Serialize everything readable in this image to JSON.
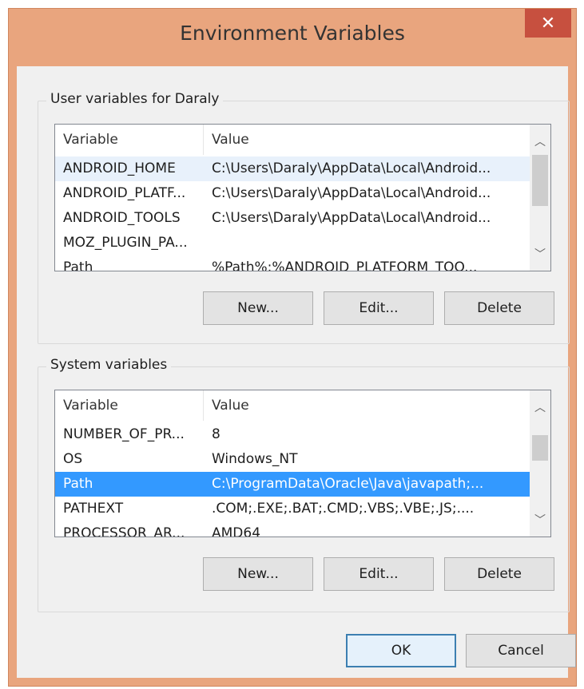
{
  "window": {
    "title": "Environment Variables",
    "close_glyph": "✕"
  },
  "user_group": {
    "label": "User variables for Daraly",
    "headers": {
      "variable": "Variable",
      "value": "Value"
    },
    "rows": [
      {
        "variable": "ANDROID_HOME",
        "value": "C:\\Users\\Daraly\\AppData\\Local\\Android..."
      },
      {
        "variable": "ANDROID_PLATF...",
        "value": "C:\\Users\\Daraly\\AppData\\Local\\Android..."
      },
      {
        "variable": "ANDROID_TOOLS",
        "value": "C:\\Users\\Daraly\\AppData\\Local\\Android..."
      },
      {
        "variable": "MOZ_PLUGIN_PA...",
        "value": ""
      },
      {
        "variable": "Path",
        "value": "%Path%;%ANDROID_PLATFORM_TOO..."
      }
    ],
    "buttons": {
      "new": "New...",
      "edit": "Edit...",
      "delete": "Delete"
    }
  },
  "system_group": {
    "label": "System variables",
    "headers": {
      "variable": "Variable",
      "value": "Value"
    },
    "rows": [
      {
        "variable": "NUMBER_OF_PR...",
        "value": "8"
      },
      {
        "variable": "OS",
        "value": "Windows_NT"
      },
      {
        "variable": "Path",
        "value": "C:\\ProgramData\\Oracle\\Java\\javapath;..."
      },
      {
        "variable": "PATHEXT",
        "value": ".COM;.EXE;.BAT;.CMD;.VBS;.VBE;.JS;...."
      },
      {
        "variable": "PROCESSOR_AR...",
        "value": "AMD64"
      }
    ],
    "buttons": {
      "new": "New...",
      "edit": "Edit...",
      "delete": "Delete"
    }
  },
  "footer": {
    "ok": "OK",
    "cancel": "Cancel"
  },
  "icons": {
    "scroll_up": "︿",
    "scroll_down": "﹀"
  },
  "colors": {
    "title_bar": "#e9a57e",
    "close_button": "#c7503f",
    "selection": "#3399ff",
    "hover_row": "#e8f1fb"
  }
}
